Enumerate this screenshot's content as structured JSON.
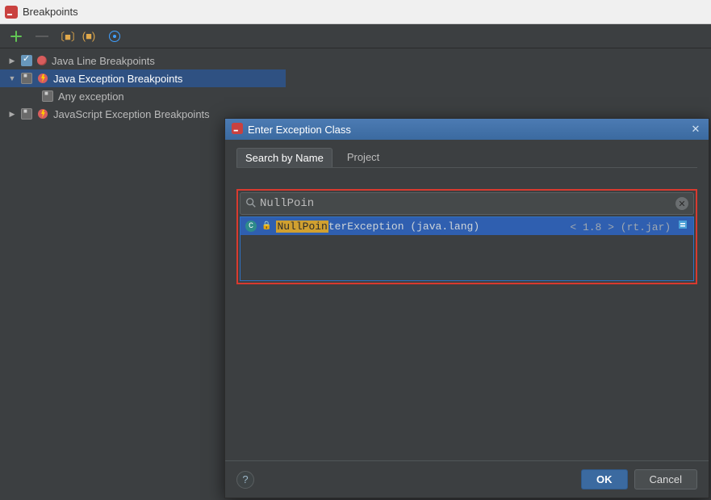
{
  "titlebar": {
    "title": "Breakpoints"
  },
  "tree": {
    "items": [
      {
        "label": "Java Line Breakpoints"
      },
      {
        "label": "Java Exception Breakpoints"
      },
      {
        "label": "Any exception"
      },
      {
        "label": "JavaScript Exception Breakpoints"
      }
    ]
  },
  "modal": {
    "title": "Enter Exception Class",
    "tabs": {
      "search": "Search by Name",
      "project": "Project"
    },
    "search_value": "NullPoin",
    "result": {
      "match": "NullPoin",
      "rest": "terException",
      "pkg": "(java.lang)",
      "jdk": "< 1.8 >",
      "jar": "(rt.jar)"
    },
    "buttons": {
      "ok": "OK",
      "cancel": "Cancel"
    }
  }
}
